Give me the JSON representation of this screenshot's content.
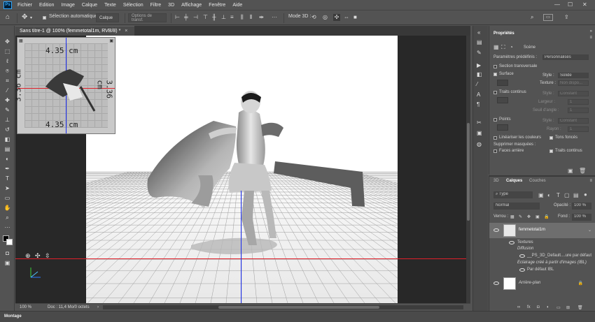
{
  "menu": [
    "Fichier",
    "Edition",
    "Image",
    "Calque",
    "Texte",
    "Sélection",
    "Filtre",
    "3D",
    "Affichage",
    "Fenêtre",
    "Aide"
  ],
  "app_logo": "Ps",
  "options": {
    "auto_select_label": "Sélection automatique :",
    "auto_select_value": "Calque",
    "transform_label": "Options de transf.",
    "mode3d_label": "Mode 3D :"
  },
  "document": {
    "tab_title": "Sans titre-1 @ 100% (femmetotal1m, RVB/8) *",
    "zoom": "100 %",
    "doc_info": "Doc : 11,4 Mo/0 octets"
  },
  "navigator": {
    "measure_top": "4.35 cm",
    "measure_bottom": "4.35 cm",
    "measure_side": "3.36 cm"
  },
  "timeline_label": "Montage",
  "properties": {
    "title": "Propriétés",
    "subtitle": "Scène",
    "presets_label": "Paramètres prédéfinis :",
    "presets_value": "Personnalisés",
    "cross_section": "Section transversale",
    "surface": "Surface",
    "style_label": "Style :",
    "surface_style": "Solide",
    "texture_label": "Texture :",
    "texture_value": "Non dispo...",
    "lines": "Traits continus",
    "line_style": "Constant",
    "width_label": "Largeur :",
    "width_value": "1",
    "angle_label": "Seuil d'angle :",
    "angle_value": "1",
    "points": "Points",
    "point_style": "Constant",
    "radius_label": "Rayon :",
    "radius_value": "1",
    "linearize": "Linéariser les couleurs",
    "backfaces": "Tons foncés",
    "remove_hidden": "Supprimer masquées :",
    "back_faces": "Faces arrière",
    "hidden_lines": "Traits continus"
  },
  "layers": {
    "tabs": [
      "3D",
      "Calques",
      "Couches"
    ],
    "kind_filter": "Type",
    "blend_mode": "Normal",
    "opacity_label": "Opacité :",
    "opacity_value": "100 %",
    "lock_label": "Verrou :",
    "fill_label": "Fond :",
    "fill_value": "100 %",
    "items": [
      {
        "name": "femmetotal1m"
      },
      {
        "name": "Textures"
      },
      {
        "name": "Diffusion"
      },
      {
        "name": "__PS_3D_Default....ure par défaut"
      },
      {
        "name": "Eclairage créé à partir d'images (IBL)"
      },
      {
        "name": "Par défaut IBL"
      },
      {
        "name": "Arrière-plan"
      }
    ]
  },
  "colors": {
    "guide_red": "#e0202a",
    "guide_blue": "#1a2cf0",
    "accent": "#31a8ff"
  }
}
